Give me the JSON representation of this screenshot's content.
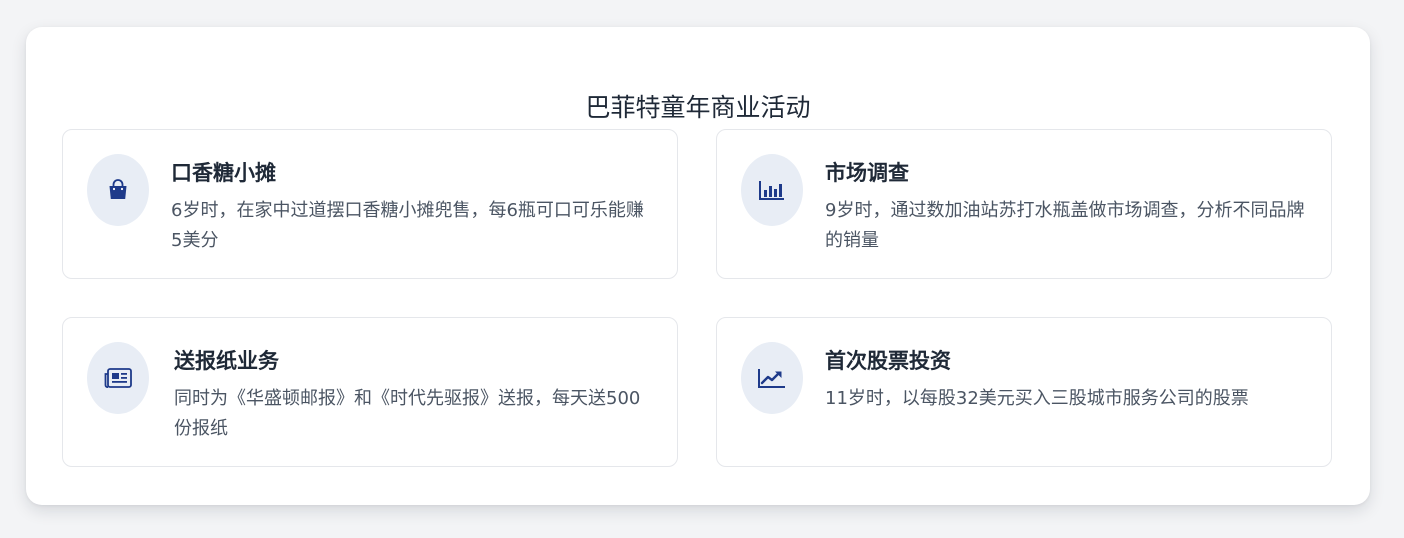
{
  "panel": {
    "title": "巴菲特童年商业活动"
  },
  "colors": {
    "icon": "#1e3a8a",
    "icon_bg": "#e8edf5",
    "card_border": "#e5e7eb"
  },
  "cards": [
    {
      "title": "口香糖小摊",
      "description": "6岁时，在家中过道摆口香糖小摊兜售，每6瓶可口可乐能赚5美分",
      "icon": "shopping-bag-icon"
    },
    {
      "title": "市场调查",
      "description": "9岁时，通过数加油站苏打水瓶盖做市场调查，分析不同品牌的销量",
      "icon": "bar-chart-icon"
    },
    {
      "title": "送报纸业务",
      "description": "同时为《华盛顿邮报》和《时代先驱报》送报，每天送500份报纸",
      "icon": "newspaper-icon"
    },
    {
      "title": "首次股票投资",
      "description": "11岁时，以每股32美元买入三股城市服务公司的股票",
      "icon": "line-chart-icon"
    }
  ]
}
